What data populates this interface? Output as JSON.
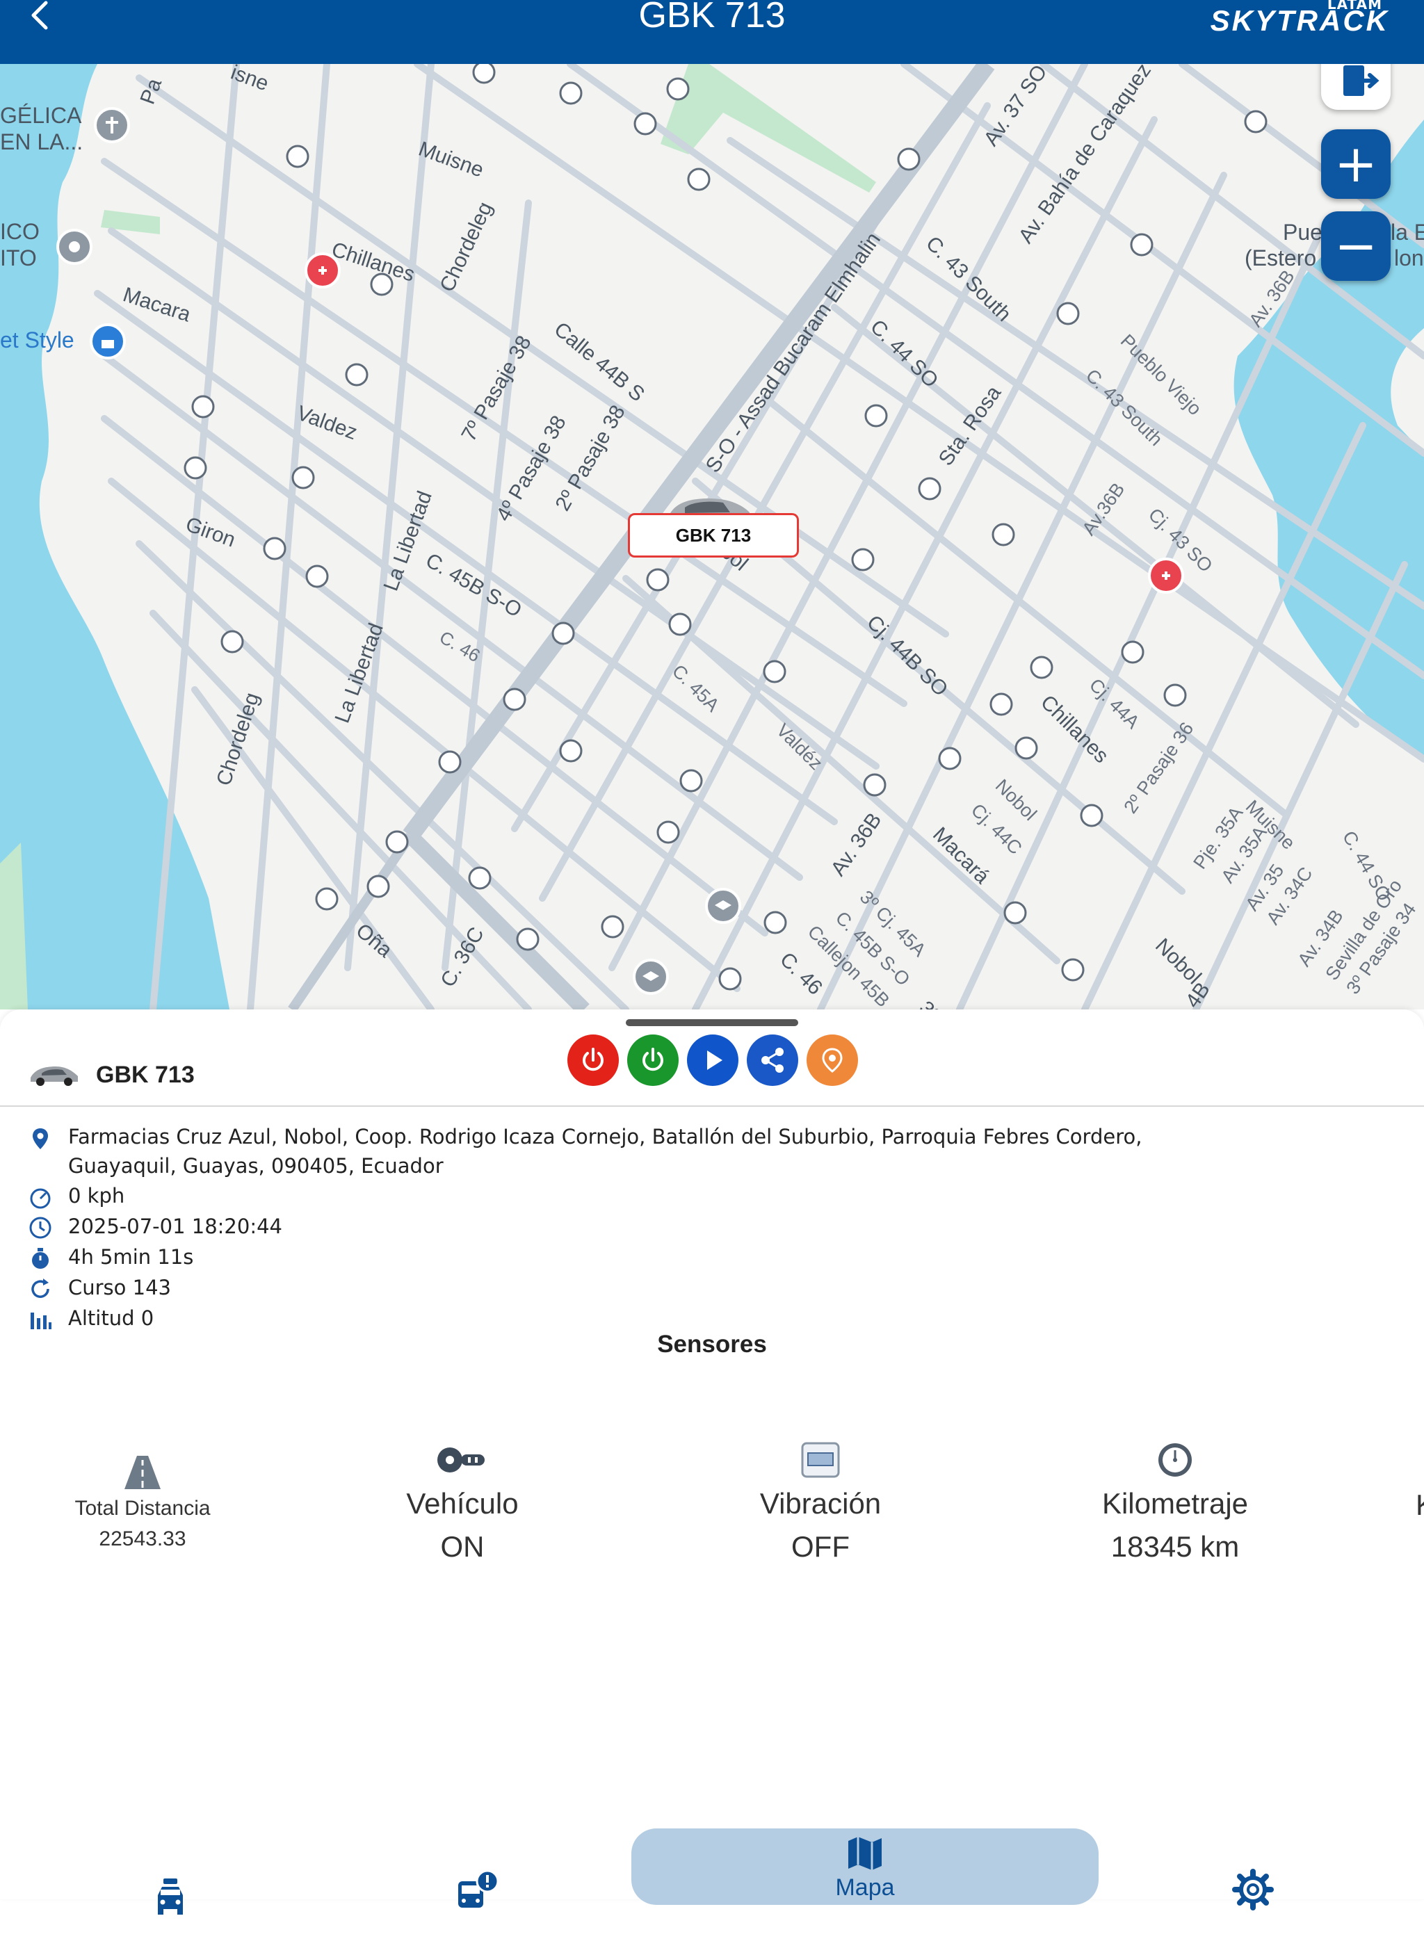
{
  "header": {
    "title": "GBK 713",
    "brand_top": "LATAM",
    "brand_main": "SKYTRACK"
  },
  "map": {
    "car_label": "GBK 713",
    "streets": [
      "Muisne",
      "Chillanes",
      "Chordeleg",
      "Macara",
      "Valdez",
      "Giron",
      "La Libertad",
      "7º Pasaje 38",
      "4º Pasaje 38",
      "2º Pasaje 38",
      "Calle 44B S",
      "C. 45B S-O",
      "C. 46",
      "S-O - Assad Bucaram Elmhalin",
      "Nobol",
      "C. 44 SO",
      "C. 43 South",
      "Av. Bahía de Caraquez",
      "Av. 37 SO",
      "Sta. Rosa",
      "Pueblo Viejo",
      "Av.36B",
      "Cj. 43 SO",
      "Cj. 44B SO",
      "C. 45A",
      "Valdéz",
      "Av. 36B",
      "Macará",
      "Cj. 44C",
      "Cj. 44A",
      "2º Pasaje 36",
      "Oña",
      "Callejon 45B",
      "Pje. 35A",
      "Av. 35A",
      "Av. 35",
      "Av. 34C",
      "Av. 34B",
      "Sevilla de Oro",
      "C. 44 SO"
    ],
    "place_labels": [
      "GÉLICA",
      "EN LA...",
      "ICO",
      "ITO",
      "et Style",
      "Pue",
      "la E",
      "(Estero",
      "lon"
    ],
    "zoom_in_label": "+",
    "zoom_out_label": "−"
  },
  "vehicle": {
    "name": "GBK 713",
    "address_line1": "Farmacias Cruz Azul, Nobol, Coop. Rodrigo Icaza Cornejo, Batallón del Suburbio, Parroquia Febres Cordero,",
    "address_line2": "Guayaquil, Guayas, 090405, Ecuador",
    "speed": "0 kph",
    "datetime": "2025-07-01 18:20:44",
    "duration": "4h 5min 11s",
    "course": "Curso 143",
    "altitude": "Altitud 0"
  },
  "actions": [
    {
      "icon": "power-off-icon",
      "color": "#e32219"
    },
    {
      "icon": "power-on-icon",
      "color": "#19962c"
    },
    {
      "icon": "play-icon",
      "color": "#1055c9"
    },
    {
      "icon": "share-icon",
      "color": "#1a58c7"
    },
    {
      "icon": "location-pin-icon",
      "color": "#f0883a"
    }
  ],
  "sensors": {
    "title": "Sensores",
    "items": [
      {
        "label": "Total Distancia",
        "value": "22543.33",
        "icon": "road-icon"
      },
      {
        "label": "Vehículo",
        "value": "ON",
        "icon": "ignition-key-icon"
      },
      {
        "label": "Vibración",
        "value": "OFF",
        "icon": "vibration-sensor-icon"
      },
      {
        "label": "Kilometraje",
        "value": "18345 km",
        "icon": "odometer-icon"
      },
      {
        "label": "K",
        "value": "",
        "icon": ""
      }
    ]
  },
  "nav": {
    "items": [
      {
        "label": "",
        "icon": "vehicles-icon"
      },
      {
        "label": "",
        "icon": "bus-alert-icon"
      },
      {
        "label": "Mapa",
        "icon": "map-icon",
        "active": true
      },
      {
        "label": "",
        "icon": "settings-icon"
      }
    ]
  },
  "colors": {
    "primary": "#00509a",
    "water": "#8ed6ec",
    "park": "#c4e8cd",
    "road": "#c8d1db",
    "active_nav": "#b4cde3"
  }
}
